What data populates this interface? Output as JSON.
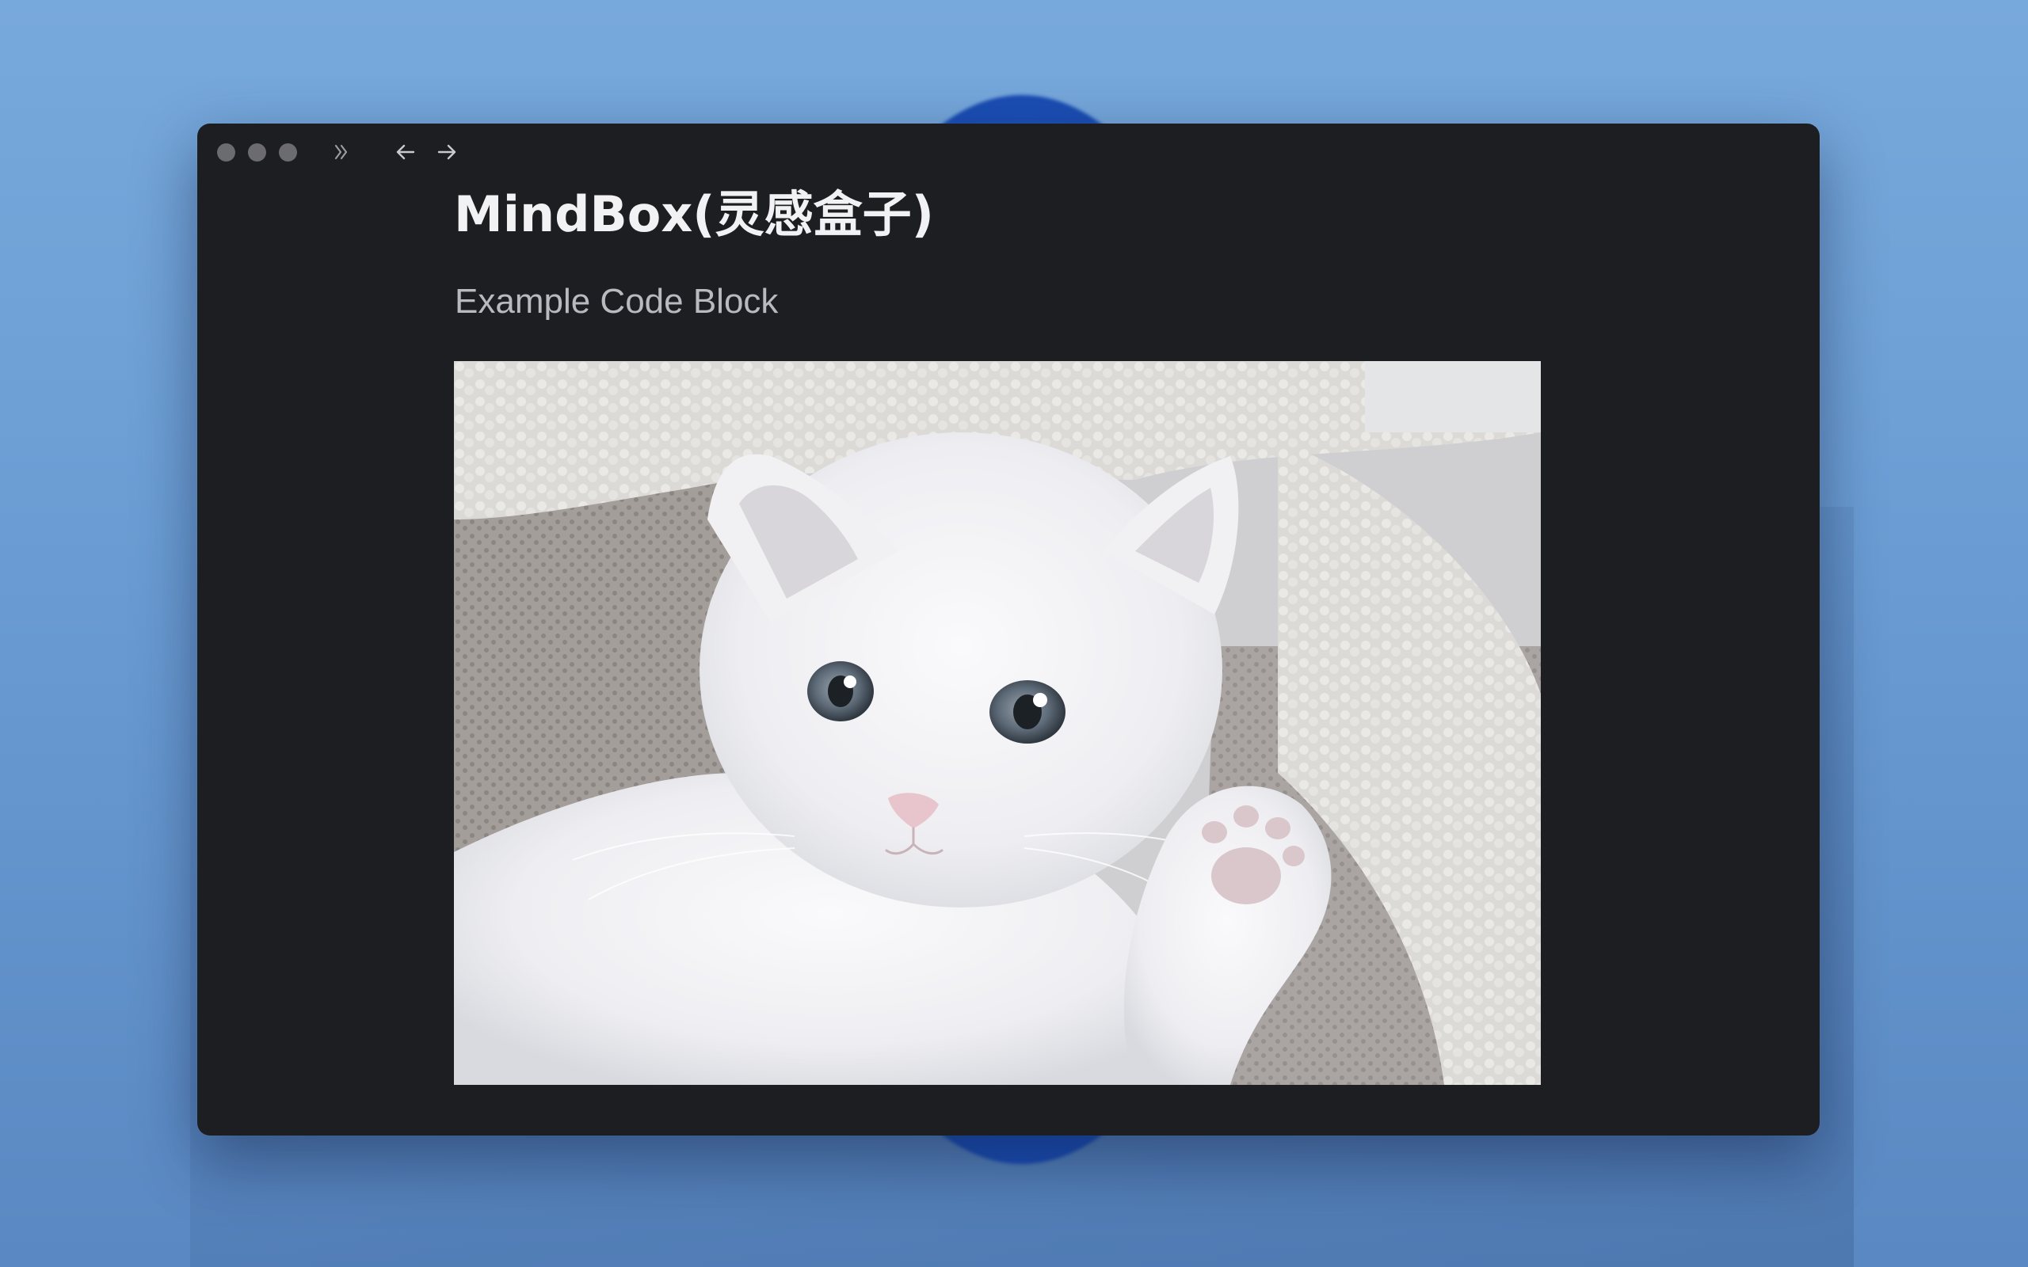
{
  "document": {
    "title": "MindBox(灵感盒子)",
    "heading": "Example Code Block"
  },
  "toolbar": {
    "icons": [
      "expand-sidebar-icon",
      "back-arrow-icon",
      "forward-arrow-icon"
    ]
  },
  "image": {
    "subject": "kitten-photo"
  },
  "colors": {
    "window_background": "#1d1e22",
    "title_text": "#f2f2f4",
    "heading_text": "#b9babf",
    "traffic_light": "#6b6b70",
    "wallpaper": "#78a9dc"
  }
}
